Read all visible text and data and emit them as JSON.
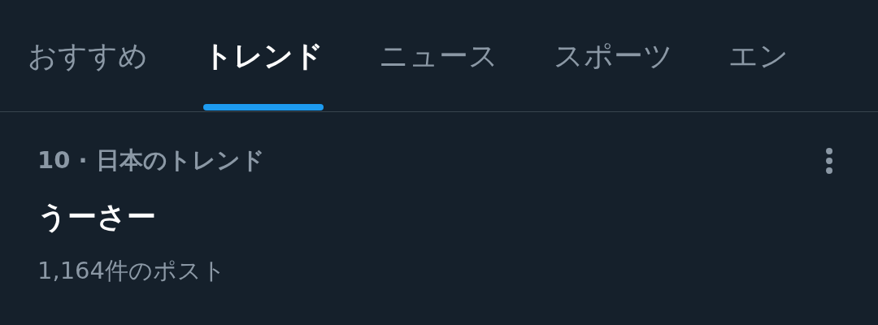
{
  "tabs": [
    {
      "label": "おすすめ",
      "selected": false
    },
    {
      "label": "トレンド",
      "selected": true
    },
    {
      "label": "ニュース",
      "selected": false
    },
    {
      "label": "スポーツ",
      "selected": false
    },
    {
      "label": "エン",
      "selected": false
    }
  ],
  "trends": [
    {
      "context": "10 · 日本のトレンド",
      "title": "うーさー",
      "posts": "1,164件のポスト"
    }
  ]
}
